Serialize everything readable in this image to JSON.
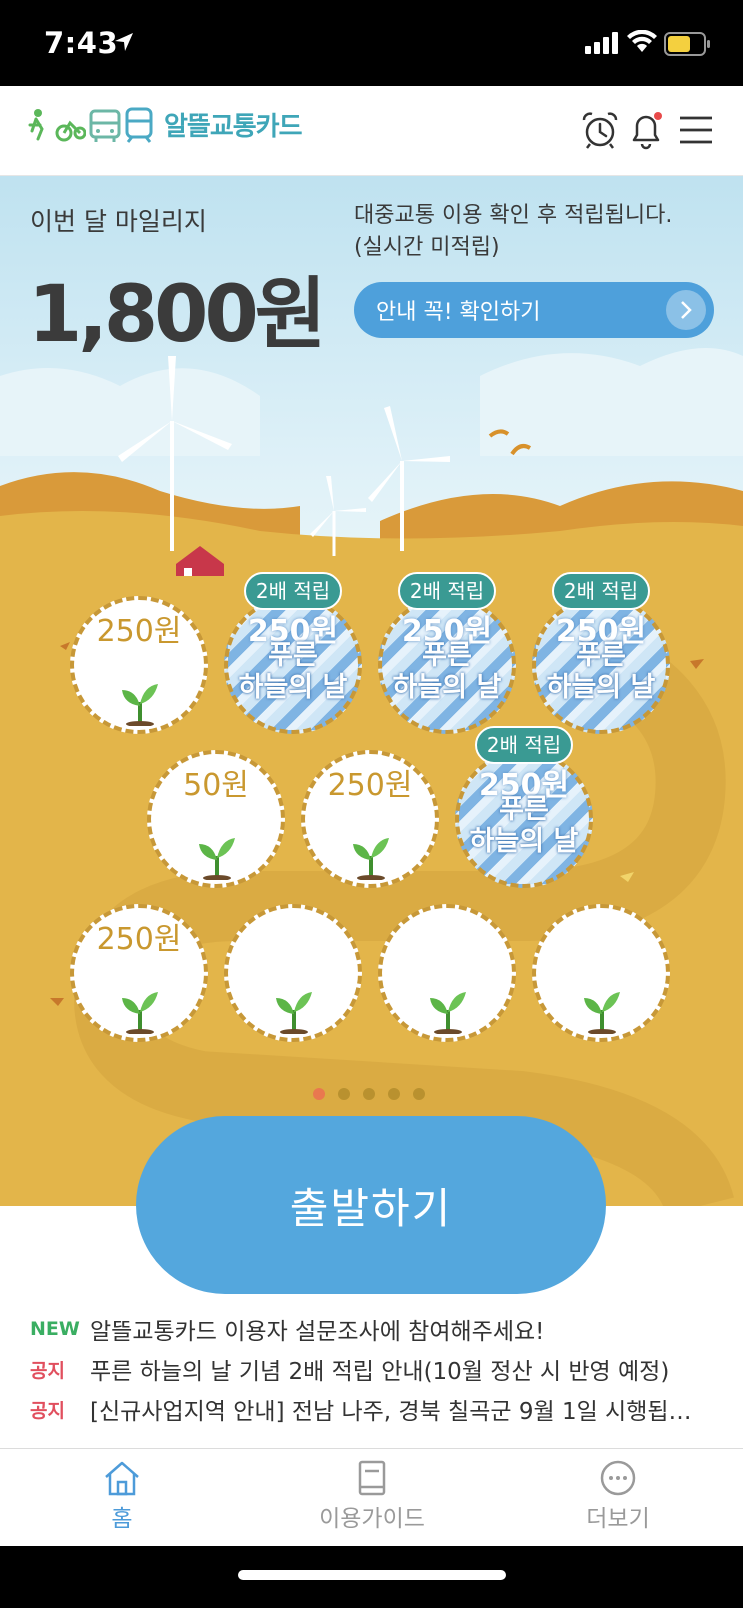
{
  "status_bar": {
    "time": "7:43"
  },
  "header": {
    "logo_text": "알뜰교통카드",
    "icons": [
      "bike-icon",
      "bus-icon",
      "train-icon",
      "alarm-clock-icon",
      "bell-icon",
      "menu-icon"
    ],
    "bell_has_badge": true
  },
  "mileage": {
    "label": "이번 달 마일리지",
    "amount": "1,800원"
  },
  "notice_text": {
    "line1": "대중교통 이용 확인 후 적립됩니다.",
    "line2": "(실시간 미적립)"
  },
  "guide_button": {
    "label": "안내 꼭! 확인하기"
  },
  "coins": [
    {
      "amount": "250원",
      "title": "",
      "badge": "",
      "style": "plain"
    },
    {
      "amount": "250원",
      "title": "푸른\n하늘의 날",
      "badge": "2배 적립",
      "style": "blue"
    },
    {
      "amount": "250원",
      "title": "푸른\n하늘의 날",
      "badge": "2배 적립",
      "style": "blue"
    },
    {
      "amount": "250원",
      "title": "푸른\n하늘의 날",
      "badge": "2배 적립",
      "style": "blue"
    },
    {
      "amount": "50원",
      "title": "",
      "badge": "",
      "style": "plain"
    },
    {
      "amount": "250원",
      "title": "",
      "badge": "",
      "style": "plain"
    },
    {
      "amount": "250원",
      "title": "푸른\n하늘의 날",
      "badge": "2배 적립",
      "style": "blue"
    },
    {
      "amount": "250원",
      "title": "",
      "badge": "",
      "style": "plain"
    },
    {
      "amount": "",
      "title": "",
      "badge": "",
      "style": "plain"
    },
    {
      "amount": "",
      "title": "",
      "badge": "",
      "style": "plain"
    },
    {
      "amount": "",
      "title": "",
      "badge": "",
      "style": "plain"
    }
  ],
  "pagination": {
    "total": 5,
    "current": 1
  },
  "start_button": {
    "label": "출발하기"
  },
  "notices": [
    {
      "tag": "NEW",
      "title": "알뜰교통카드 이용자 설문조사에 참여해주세요!"
    },
    {
      "tag": "공지",
      "title": "푸른 하늘의 날 기념 2배 적립 안내(10월 정산 시 반영 예정)"
    },
    {
      "tag": "공지",
      "title": "[신규사업지역 안내] 전남 나주, 경북 칠곡군 9월 1일 시행됩니…"
    }
  ],
  "tabs": [
    {
      "label": "홈",
      "icon": "home-icon",
      "active": true
    },
    {
      "label": "이용가이드",
      "icon": "book-icon",
      "active": false
    },
    {
      "label": "더보기",
      "icon": "more-icon",
      "active": false
    }
  ],
  "colors": {
    "accent_blue": "#4ea0db",
    "badge_teal": "#3a9a93",
    "ground": "#e3b54a",
    "new_tag": "#3aae62",
    "notice_tag": "#e14f5e"
  }
}
